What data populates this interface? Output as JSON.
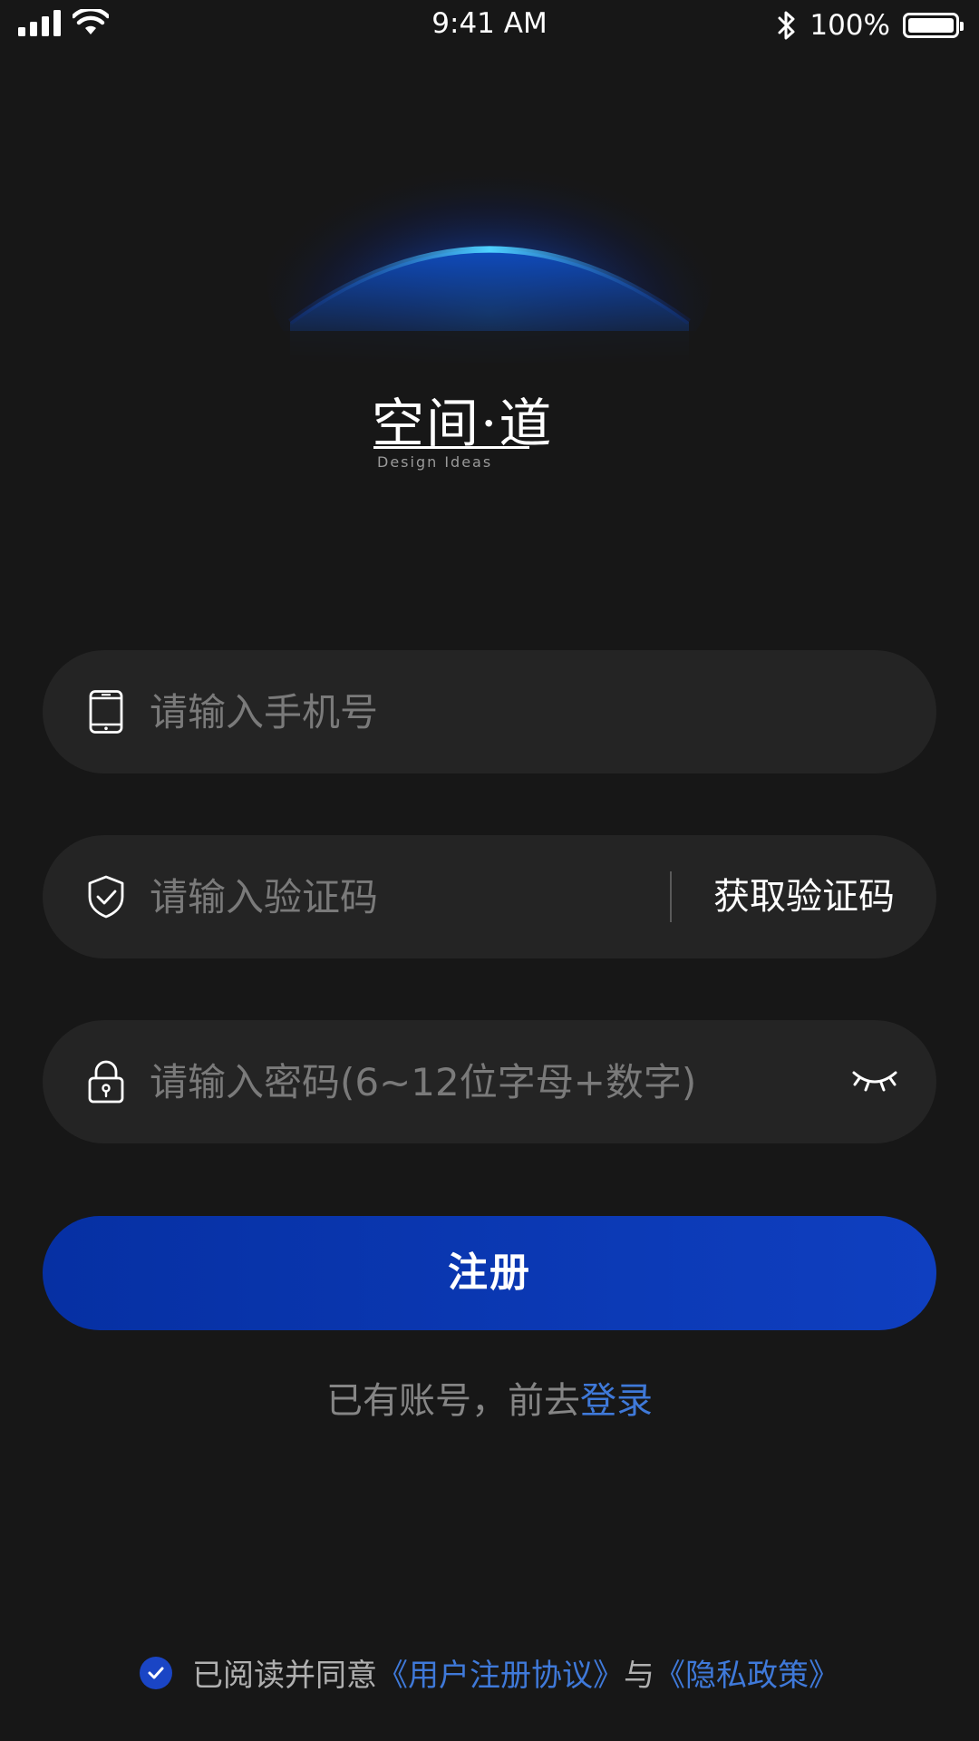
{
  "status_bar": {
    "time": "9:41 AM",
    "battery_percent": "100%",
    "signal_icon": "cellular-signal-icon",
    "wifi_icon": "wifi-icon",
    "bluetooth_icon": "bluetooth-icon",
    "battery_icon": "battery-icon",
    "battery_level": 1.0
  },
  "logo": {
    "title": "空间·道",
    "subtitle": "Design Ideas",
    "planet_icon": "planet-horizon-icon"
  },
  "form": {
    "phone": {
      "placeholder": "请输入手机号",
      "value": "",
      "icon": "mobile-phone-icon"
    },
    "code": {
      "placeholder": "请输入验证码",
      "value": "",
      "icon": "shield-check-icon",
      "get_code_label": "获取验证码"
    },
    "password": {
      "placeholder": "请输入密码(6~12位字母+数字)",
      "value": "",
      "icon": "lock-icon",
      "toggle_icon": "eye-closed-icon"
    }
  },
  "register_button": {
    "label": "注册"
  },
  "login_prompt": {
    "text": "已有账号，前去",
    "link": "登录"
  },
  "agreement": {
    "checked": true,
    "prefix": "已阅读并同意",
    "terms_link": "《用户注册协议》",
    "conjunction": "与",
    "privacy_link": "《隐私政策》"
  },
  "colors": {
    "background": "#171717",
    "field_background": "#242424",
    "primary": "#0f3fc0",
    "link": "#3f79d9",
    "placeholder": "#7a7a7a"
  }
}
